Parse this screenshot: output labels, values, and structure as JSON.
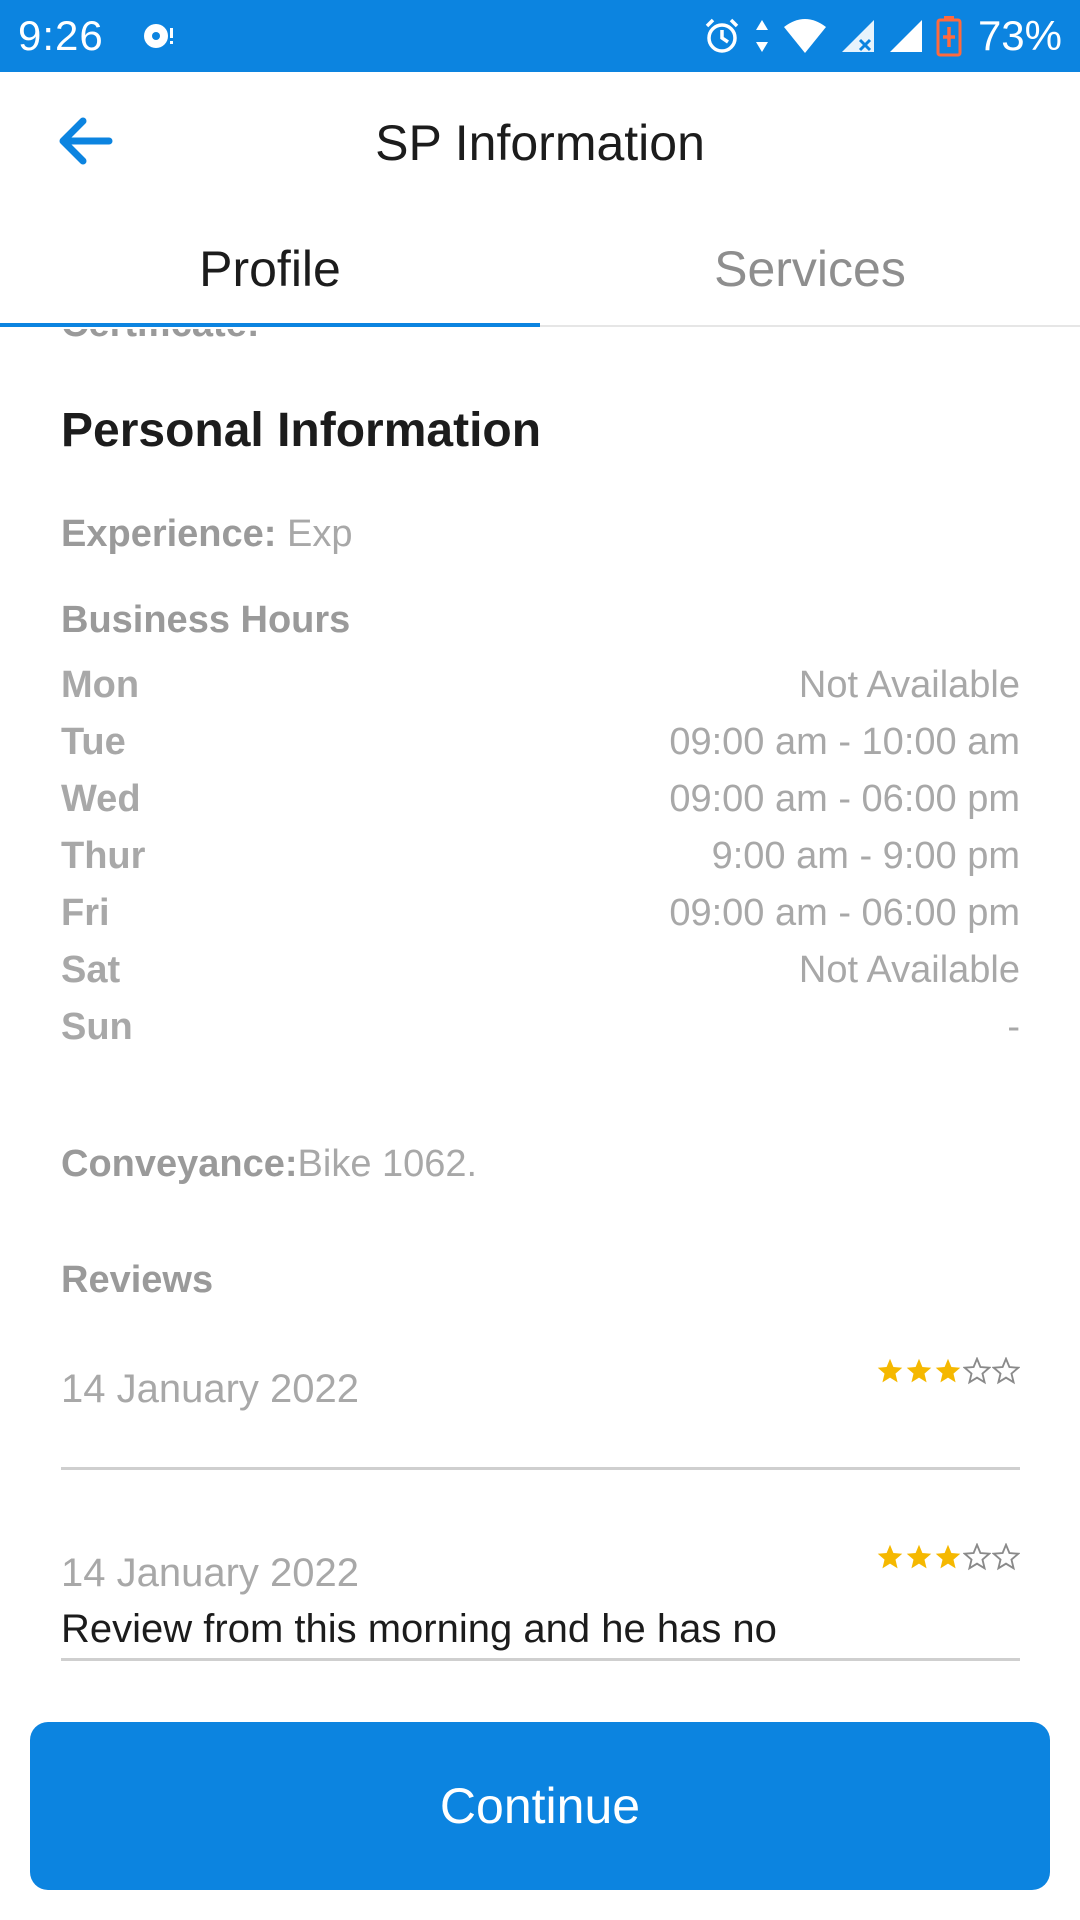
{
  "status_bar": {
    "time": "9:26",
    "battery": "73%"
  },
  "toolbar": {
    "title": "SP Information",
    "back_icon": "arrow-left-icon"
  },
  "tabs": [
    {
      "label": "Profile",
      "active": true
    },
    {
      "label": "Services",
      "active": false
    }
  ],
  "profile": {
    "certificate_label": "Certificate:",
    "section_title": "Personal Information",
    "experience_label": "Experience:",
    "experience_value": "Exp",
    "business_hours_title": "Business Hours",
    "business_hours": [
      {
        "day": "Mon",
        "hours": "Not Available"
      },
      {
        "day": "Tue",
        "hours": "09:00 am - 10:00 am"
      },
      {
        "day": "Wed",
        "hours": "09:00 am - 06:00 pm"
      },
      {
        "day": "Thur",
        "hours": "9:00 am - 9:00 pm"
      },
      {
        "day": "Fri",
        "hours": "09:00 am - 06:00 pm"
      },
      {
        "day": "Sat",
        "hours": "Not Available"
      },
      {
        "day": "Sun",
        "hours": "-"
      }
    ],
    "conveyance_label": "Conveyance:",
    "conveyance_value": "Bike 1062.",
    "reviews_title": "Reviews",
    "reviews": [
      {
        "date": "14 January 2022",
        "text": "",
        "rating": 3,
        "max_rating": 5
      },
      {
        "date": "14 January 2022",
        "text": "Review from this morning and he has no",
        "rating": 3,
        "max_rating": 5
      }
    ]
  },
  "continue_button": {
    "label": "Continue"
  },
  "colors": {
    "primary": "#0c84e0",
    "star": "#f5b800",
    "muted_text": "#a8a8a8"
  }
}
